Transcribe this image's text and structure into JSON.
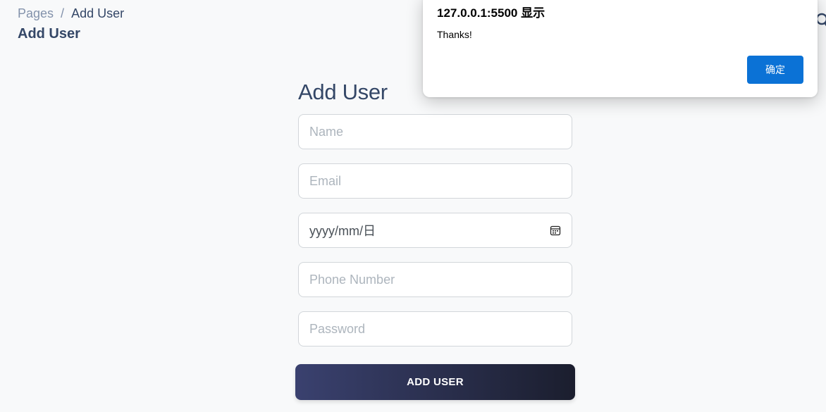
{
  "breadcrumb": {
    "root": "Pages",
    "separator": "/",
    "current": "Add User"
  },
  "header": {
    "title": "Add User"
  },
  "form": {
    "title": "Add User",
    "name_placeholder": "Name",
    "email_placeholder": "Email",
    "date_placeholder": "yyyy/mm/日",
    "phone_placeholder": "Phone Number",
    "password_placeholder": "Password",
    "submit_label": "ADD USER"
  },
  "alert": {
    "title": "127.0.0.1:5500 显示",
    "message": "Thanks!",
    "ok_label": "确定"
  },
  "colors": {
    "background": "#f8f9fa",
    "text_dark": "#344767",
    "muted": "#8392ab",
    "button_gradient_start": "#3a416f",
    "button_gradient_end": "#1b1e2e",
    "alert_button": "#0b72d6"
  },
  "icons": {
    "date_field": "calendar-icon",
    "corner": "search-icon"
  }
}
